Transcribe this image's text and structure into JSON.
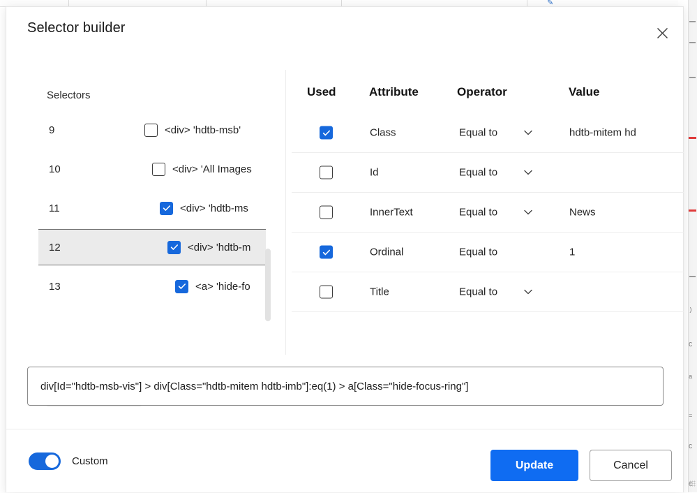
{
  "dialog": {
    "title": "Selector builder",
    "close_icon": "close-icon"
  },
  "selectors_panel": {
    "header": "Selectors",
    "rows": [
      {
        "index": "9",
        "checked": false,
        "label": "<div> 'hdtb-msb'",
        "indent": 0
      },
      {
        "index": "10",
        "checked": false,
        "label": "<div> 'All  Images",
        "indent": 11
      },
      {
        "index": "11",
        "checked": true,
        "label": "<div> 'hdtb-ms",
        "indent": 22
      },
      {
        "index": "12",
        "checked": true,
        "label": "<div> 'hdtb-m",
        "indent": 33
      },
      {
        "index": "13",
        "checked": true,
        "label": "<a> 'hide-fo",
        "indent": 44
      }
    ],
    "selected_index": "12"
  },
  "attributes_panel": {
    "columns": {
      "used": "Used",
      "attribute": "Attribute",
      "operator": "Operator",
      "value": "Value"
    },
    "rows": [
      {
        "used": true,
        "attribute": "Class",
        "operator": "Equal to",
        "value": "hdtb-mitem hd",
        "has_chevron": true
      },
      {
        "used": false,
        "attribute": "Id",
        "operator": "Equal to",
        "value": "",
        "has_chevron": true
      },
      {
        "used": false,
        "attribute": "InnerText",
        "operator": "Equal to",
        "value": "News",
        "has_chevron": true
      },
      {
        "used": true,
        "attribute": "Ordinal",
        "operator": "Equal to",
        "value": "1",
        "has_chevron": false
      },
      {
        "used": false,
        "attribute": "Title",
        "operator": "Equal to",
        "value": "",
        "has_chevron": true
      }
    ]
  },
  "expression": {
    "value": "div[Id=\"hdtb-msb-vis\"] > div[Class=\"hdtb-mitem hdtb-imb\"]:eq(1) > a[Class=\"hide-focus-ring\"]",
    "placeholder": ""
  },
  "footer": {
    "custom_toggle_label": "Custom",
    "custom_toggle_on": true,
    "update_label": "Update",
    "cancel_label": "Cancel"
  },
  "colors": {
    "accent_blue": "#1668dc",
    "primary_button": "#0f6cf2",
    "selected_row": "#ebebeb",
    "error_marker": "#e03b3b"
  }
}
